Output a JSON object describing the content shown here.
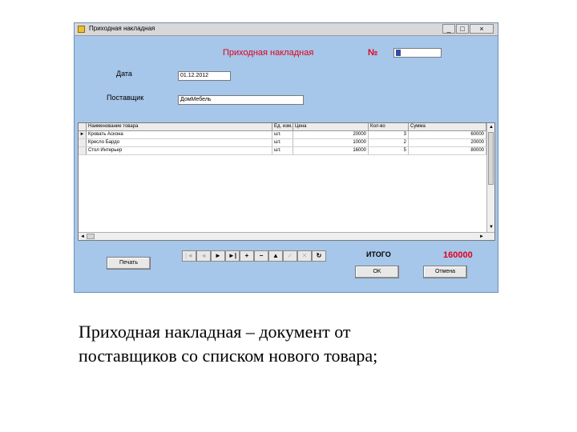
{
  "window": {
    "title": "Приходная накладная",
    "controls": {
      "minimize": "_",
      "maximize": "□",
      "close": "×"
    }
  },
  "form": {
    "heading": "Приходная накладная",
    "number_label": "№",
    "number_value": "",
    "date_label": "Дата",
    "date_value": "01.12.2012",
    "supplier_label": "Поставщик",
    "supplier_value": "ДомМебель"
  },
  "table": {
    "columns": [
      "Наименование товара",
      "Ед. изм.",
      "Цена",
      "Кол-во",
      "Сумма"
    ],
    "rows": [
      {
        "marker": "►",
        "name": "Кровать Аскона",
        "unit": "шт.",
        "price": "20000",
        "qty": "3",
        "sum": "60000"
      },
      {
        "marker": "",
        "name": "Кресло Бардо",
        "unit": "шт.",
        "price": "10000",
        "qty": "2",
        "sum": "20000"
      },
      {
        "marker": "",
        "name": "Стол Интерьер",
        "unit": "шт.",
        "price": "16000",
        "qty": "5",
        "sum": "80000"
      }
    ]
  },
  "navigator": {
    "buttons": [
      {
        "icon": "first-icon",
        "glyph": "|◄",
        "enabled": false
      },
      {
        "icon": "prior-icon",
        "glyph": "◄",
        "enabled": false
      },
      {
        "icon": "next-icon",
        "glyph": "►",
        "enabled": true
      },
      {
        "icon": "last-icon",
        "glyph": "►|",
        "enabled": true
      },
      {
        "icon": "insert-icon",
        "glyph": "+",
        "enabled": true
      },
      {
        "icon": "delete-icon",
        "glyph": "−",
        "enabled": true
      },
      {
        "icon": "edit-icon",
        "glyph": "▲",
        "enabled": true
      },
      {
        "icon": "post-icon",
        "glyph": "✓",
        "enabled": false
      },
      {
        "icon": "cancel-icon",
        "glyph": "✕",
        "enabled": false
      },
      {
        "icon": "refresh-icon",
        "glyph": "↻",
        "enabled": true
      }
    ]
  },
  "buttons": {
    "print": "Печать",
    "ok": "OK",
    "cancel": "Отмена"
  },
  "total": {
    "label": "ИТОГО",
    "value": "160000"
  },
  "caption": {
    "line1": "Приходная накладная – документ от",
    "line2": "поставщиков со списком нового товара;"
  },
  "colors": {
    "window_bg": "#a6c6ea",
    "accent_red": "#e0001c"
  }
}
